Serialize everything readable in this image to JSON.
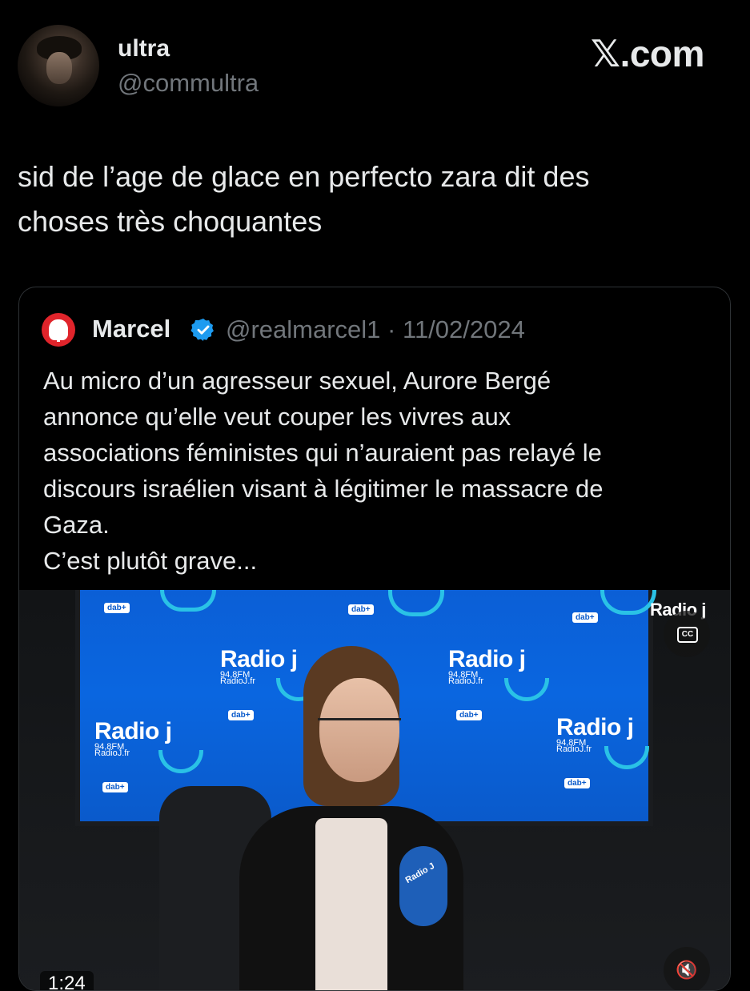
{
  "author": {
    "display_name": "ultra",
    "handle": "@commultra"
  },
  "brand": {
    "mark": "𝕏",
    "text": ".com"
  },
  "tweet": {
    "text": "sid de l’age de glace en perfecto zara dit des\nchoses très choquantes"
  },
  "quoted": {
    "name": "Marcel",
    "handle": "@realmarcel1",
    "separator": "·",
    "date": "11/02/2024",
    "text_lines": [
      "Au micro d’un agresseur sexuel, Aurore Bergé",
      "annonce qu’elle veut couper les vivres aux",
      "associations féministes qui n’auraient pas relayé le",
      "discours israélien visant à légitimer le massacre de",
      "Gaza.",
      "C’est plutôt grave..."
    ]
  },
  "video": {
    "duration": "1:24",
    "cc_label": "CC",
    "logo_word": "Radio j",
    "logo_freq": "94,8FM",
    "logo_site": "RadioJ.fr",
    "dab_label": "dab+",
    "mic_label": "Radio J",
    "corner_logo": "Radio j"
  },
  "colors": {
    "background": "#000000",
    "text": "#e7e9ea",
    "muted": "#71767b",
    "verified": "#1d9bf0",
    "border": "#2f3336",
    "screen_blue": "#0a66e0"
  },
  "icons": {
    "verified": "verified-badge-icon",
    "cc": "closed-captions-icon",
    "mute": "speaker-muted-icon"
  }
}
